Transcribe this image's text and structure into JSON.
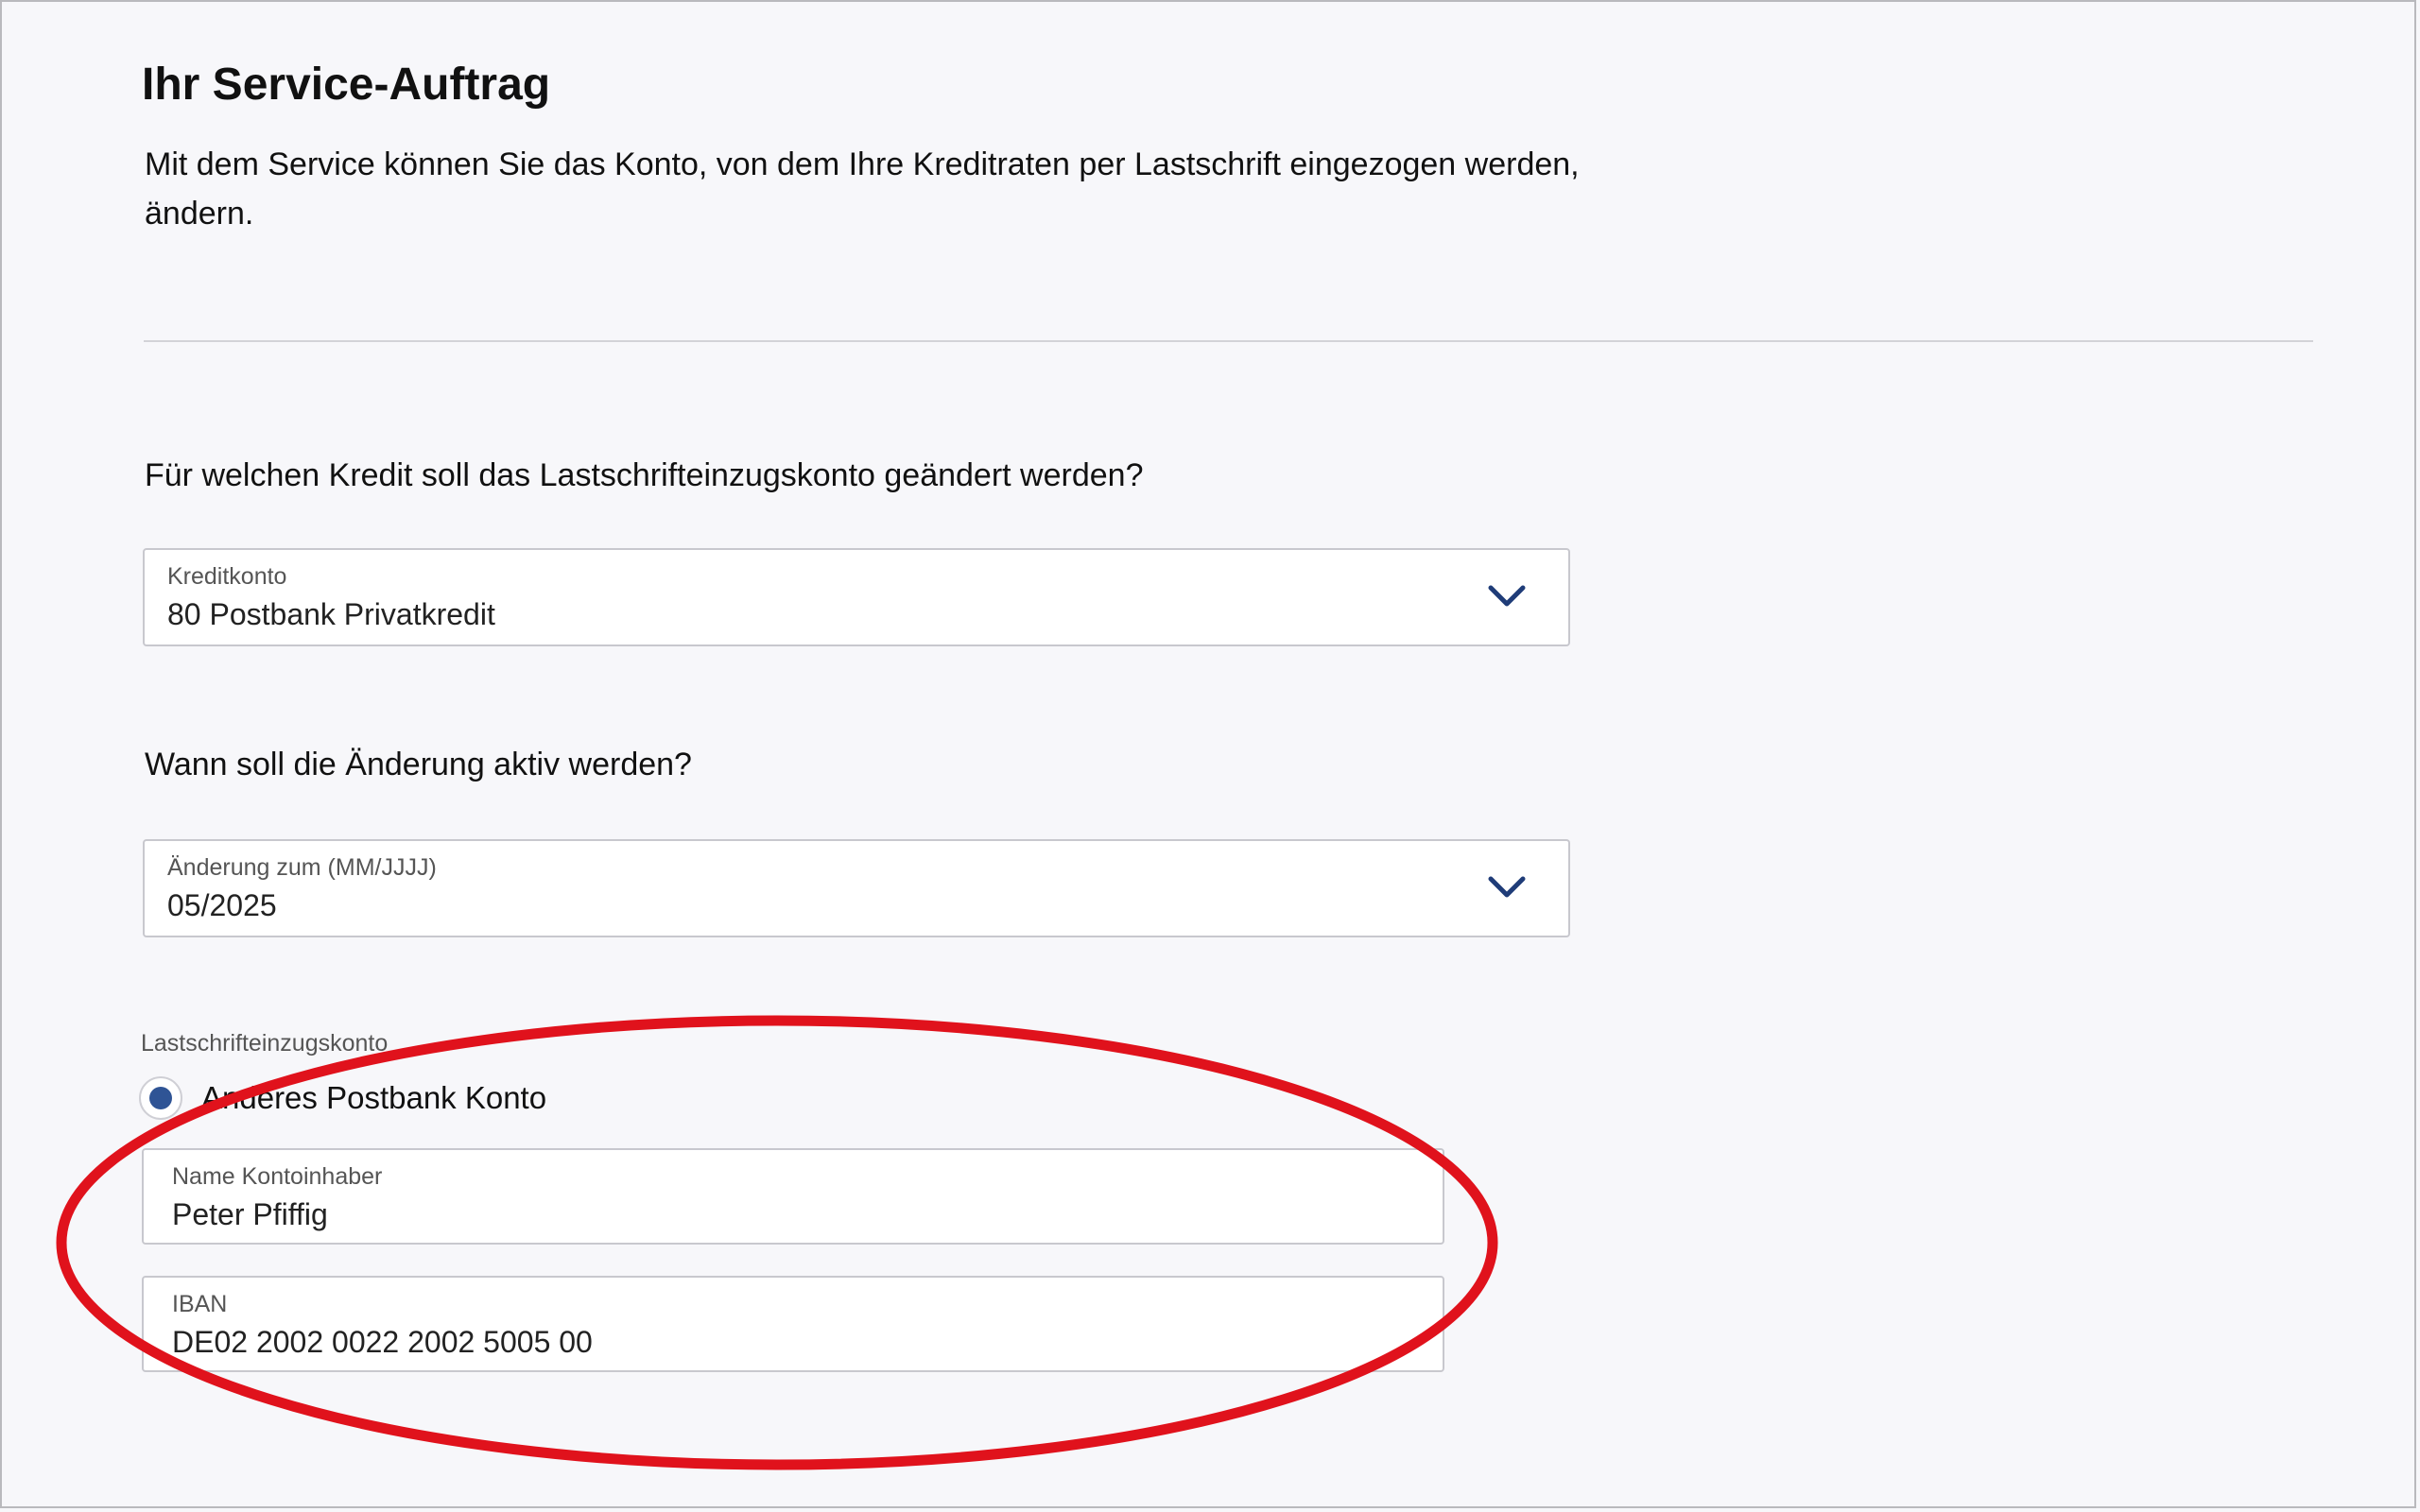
{
  "page": {
    "title": "Ihr Service-Auftrag",
    "intro": "Mit dem Service können Sie das Konto, von dem Ihre Kreditraten per Lastschrift eingezogen werden, ändern."
  },
  "credit_question": "Für welchen Kredit soll das Lastschrifteinzugskonto geändert werden?",
  "credit_select": {
    "label": "Kreditkonto",
    "value": "80 Postbank Privatkredit"
  },
  "date_question": "Wann soll die Änderung aktiv werden?",
  "date_select": {
    "label": "Änderung zum (MM/JJJJ)",
    "value": "05/2025"
  },
  "debit_account": {
    "section_label": "Lastschrifteinzugskonto",
    "option_label": "Anderes Postbank Konto",
    "selected": true
  },
  "holder_field": {
    "label": "Name Kontoinhaber",
    "value": "Peter Pfiffig"
  },
  "iban_field": {
    "label": "IBAN",
    "value": "DE02 2002 0022 2002 5005 00"
  },
  "colors": {
    "accent": "#2f5495",
    "chevron": "#1f3c78",
    "annotation": "#e0121c"
  },
  "icons": {
    "select_toggle": "chevron-down-icon",
    "highlight": "red-ellipse-annotation"
  }
}
